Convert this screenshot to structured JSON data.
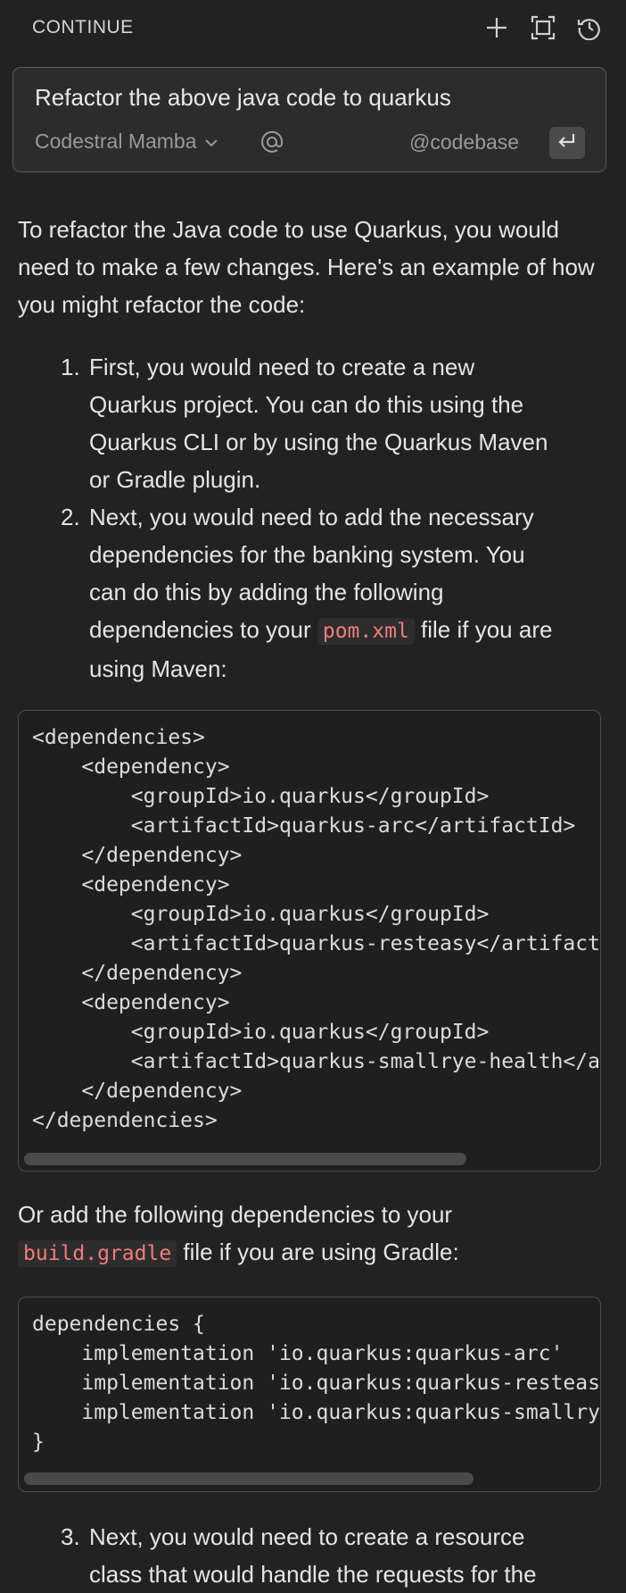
{
  "header": {
    "title": "CONTINUE"
  },
  "input": {
    "prompt": "Refactor the above java code to quarkus",
    "model": "Codestral Mamba",
    "codebase": "@codebase"
  },
  "response": {
    "intro": "To refactor the Java code to use Quarkus, you would need to make a few changes. Here's an example of how you might refactor the code:",
    "step1_num": "1.",
    "step1": "First, you would need to create a new Quarkus project. You can do this using the Quarkus CLI or by using the Quarkus Maven or Gradle plugin.",
    "step2_num": "2.",
    "step2_before": "Next, you would need to add the necessary dependencies for the banking system. You can do this by adding the following dependencies to your",
    "step2_code": "pom.xml",
    "step2_after": "file if you are using Maven:",
    "code1": "<dependencies>\n    <dependency>\n        <groupId>io.quarkus</groupId>\n        <artifactId>quarkus-arc</artifactId>\n    </dependency>\n    <dependency>\n        <groupId>io.quarkus</groupId>\n        <artifactId>quarkus-resteasy</artifactId>\n    </dependency>\n    <dependency>\n        <groupId>io.quarkus</groupId>\n        <artifactId>quarkus-smallrye-health</artifactId>\n    </dependency>\n</dependencies>",
    "para2_before": "Or add the following dependencies to your",
    "para2_code": "build.gradle",
    "para2_after": "file if you are using Gradle:",
    "code2": "dependencies {\n    implementation 'io.quarkus:quarkus-arc'\n    implementation 'io.quarkus:quarkus-resteasy'\n    implementation 'io.quarkus:quarkus-smallrye-health'\n}",
    "step3_num": "3.",
    "step3": "Next, you would need to create a resource class that would handle the requests for the"
  }
}
